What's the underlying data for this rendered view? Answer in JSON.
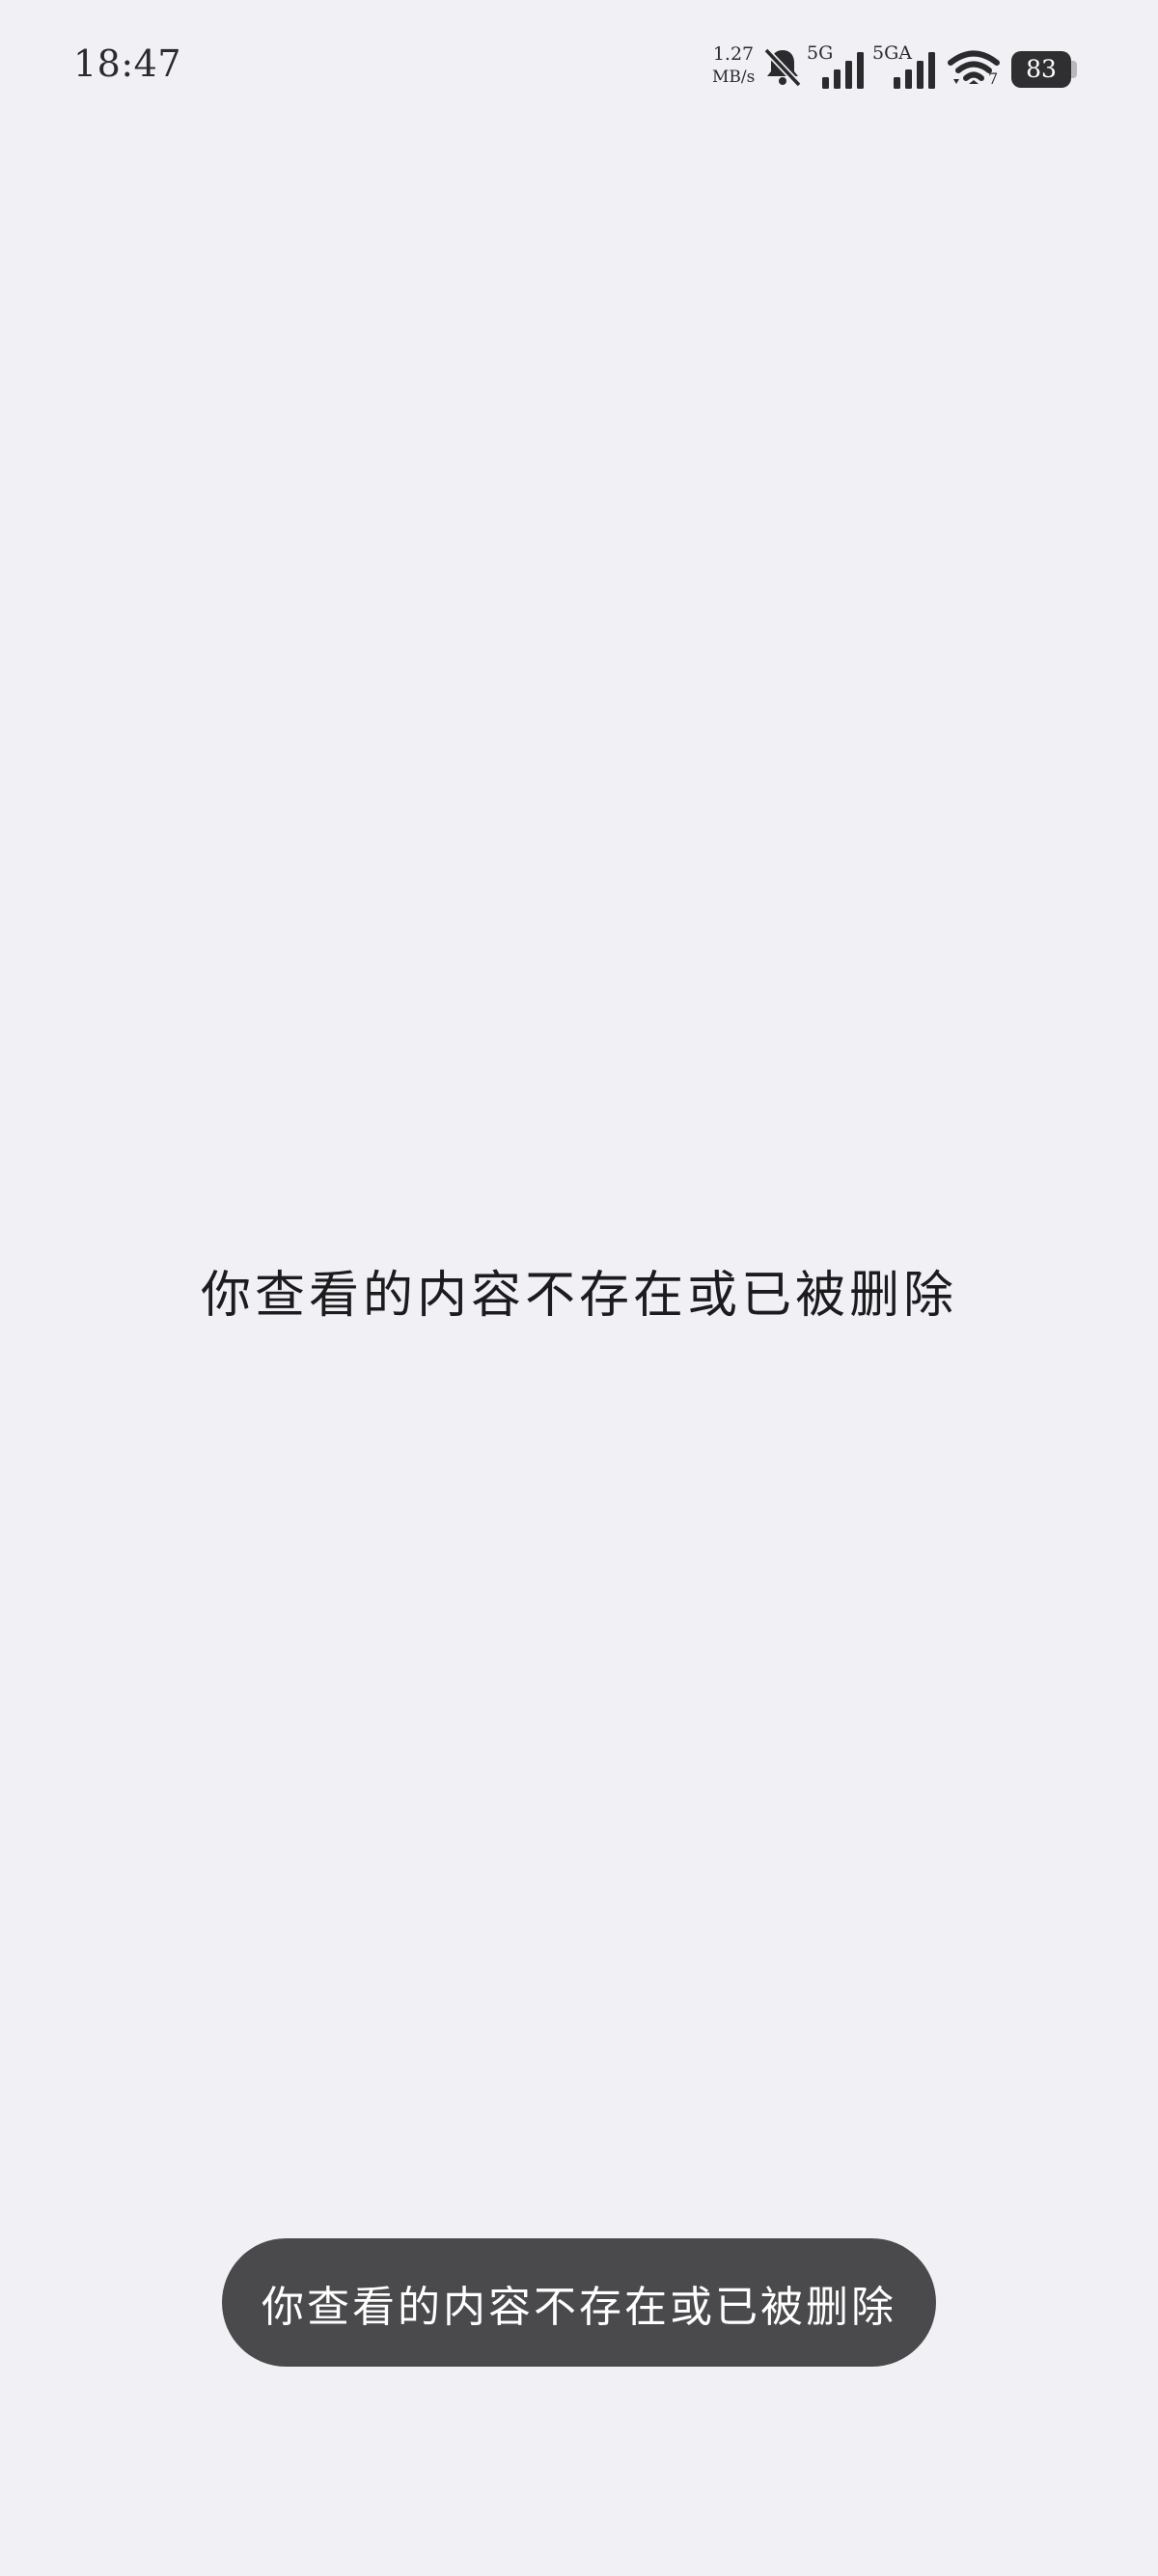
{
  "status_bar": {
    "time": "18:47",
    "net_speed_value": "1.27",
    "net_speed_unit": "MB/s",
    "sim1_label": "5G",
    "sim2_label": "5GA",
    "wifi_badge": "7",
    "battery_level": "83"
  },
  "main": {
    "message": "你查看的内容不存在或已被删除"
  },
  "toast": {
    "text": "你查看的内容不存在或已被删除"
  }
}
